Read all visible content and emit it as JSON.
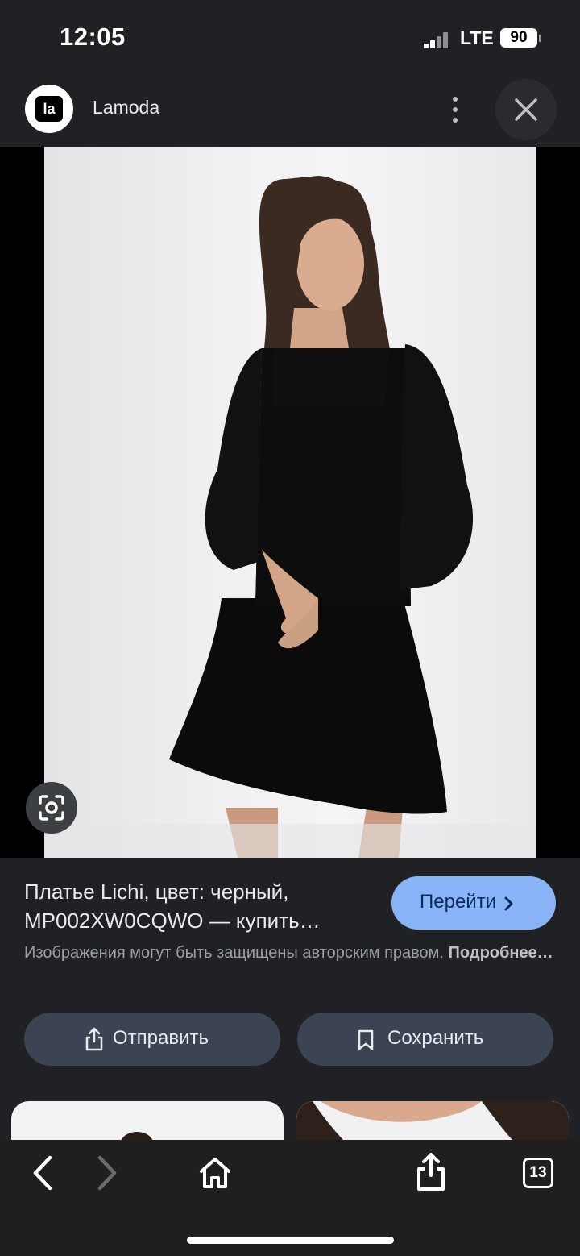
{
  "status_bar": {
    "time": "12:05",
    "network": "LTE",
    "battery": "90"
  },
  "source": {
    "logo_text": "la",
    "name": "Lamoda"
  },
  "image": {
    "alt": "Платье Lichi, цвет: черный",
    "lens_icon": "google-lens-icon"
  },
  "info": {
    "title_line1": "Платье Lichi, цвет: черный,",
    "title_line2": "MP002XW0CQWO — купить…",
    "go_button": "Перейти",
    "copyright_text": "Изображения могут быть защищены авторским правом.",
    "more_link": "Подробнее…"
  },
  "actions": {
    "share_label": "Отправить",
    "save_label": "Сохранить"
  },
  "toolbar": {
    "tabs_count": "13"
  },
  "colors": {
    "background": "#202124",
    "go_button": "#8ab4f8",
    "pill": "#3c4454",
    "toolbar": "#1f1f1f"
  }
}
